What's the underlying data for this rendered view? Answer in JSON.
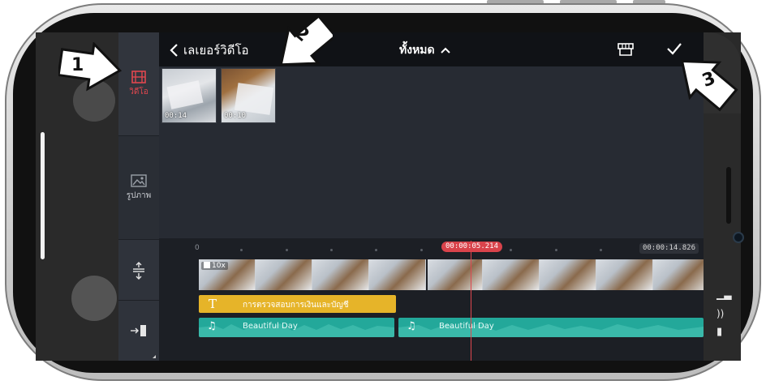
{
  "header": {
    "back_label": "เลเยอร์วิดีโอ",
    "filter_label": "ทั้งหมด",
    "store_icon": "store-icon",
    "confirm_icon": "check-icon"
  },
  "sidebar": {
    "tabs": [
      {
        "label": "วิดีโอ",
        "icon": "film-icon",
        "active": true
      },
      {
        "label": "รูปภาพ",
        "icon": "image-icon",
        "active": false
      }
    ],
    "tools": [
      {
        "icon": "split-align-icon"
      },
      {
        "icon": "layer-in-icon"
      }
    ]
  },
  "media": {
    "items": [
      {
        "duration": "00:14"
      },
      {
        "duration": "00:10"
      }
    ]
  },
  "timeline": {
    "ruler_start": "0",
    "current_time": "00:00:05.214",
    "total_time": "00:00:14.826",
    "speed_label": "10x",
    "text_clip": "การตรวจสอบการเงินและบัญชี",
    "audio_clips": [
      {
        "title": "Beautiful Day"
      },
      {
        "title": "Beautiful Day"
      }
    ]
  },
  "annotations": {
    "marker_1": "1",
    "marker_2": "2",
    "marker_3": "3"
  },
  "colors": {
    "accent_red": "#e0474f",
    "text_clip": "#e6b429",
    "audio_clip": "#23a89a",
    "screen_bg": "#272b33"
  }
}
